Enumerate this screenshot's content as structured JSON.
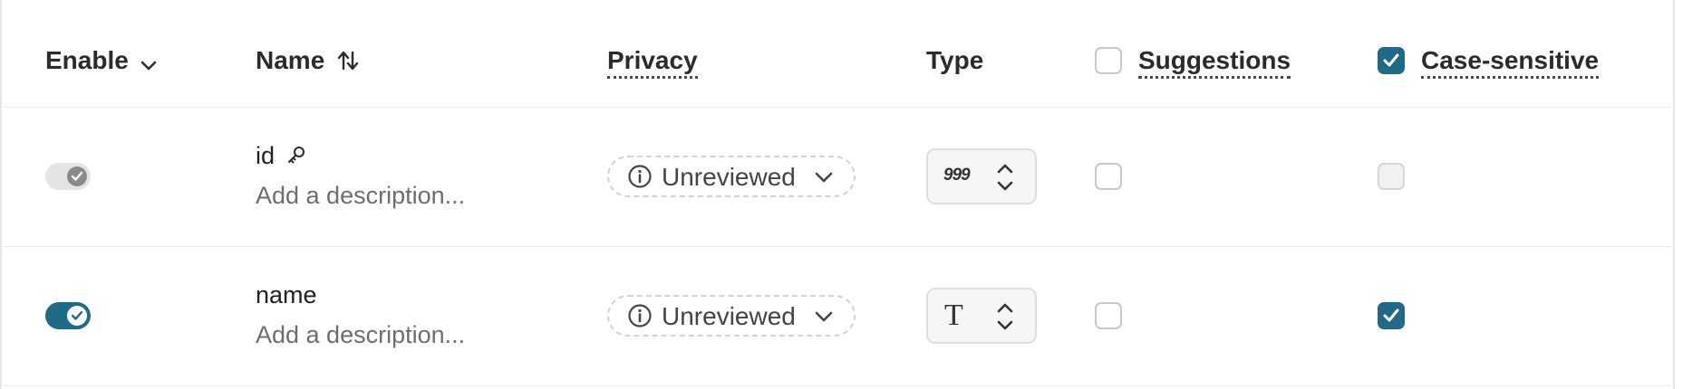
{
  "header": {
    "enable_label": "Enable",
    "name_label": "Name",
    "privacy_label": "Privacy",
    "type_label": "Type",
    "suggestions_label": "Suggestions",
    "case_sensitive_label": "Case-sensitive",
    "suggestions_all_checked": false,
    "case_sensitive_all_checked": true
  },
  "rows": [
    {
      "enabled": true,
      "enable_disabled": true,
      "name": "id",
      "is_key": true,
      "description_placeholder": "Add a description...",
      "privacy": "Unreviewed",
      "type_icon": "number-icon",
      "type_glyph": "999",
      "suggestions": false,
      "case_sensitive": false,
      "case_sensitive_disabled": true
    },
    {
      "enabled": true,
      "enable_disabled": false,
      "name": "name",
      "is_key": false,
      "description_placeholder": "Add a description...",
      "privacy": "Unreviewed",
      "type_icon": "text-icon",
      "type_glyph": "T",
      "suggestions": false,
      "case_sensitive": true,
      "case_sensitive_disabled": false
    }
  ],
  "colors": {
    "accent": "#1e6a87",
    "border": "#e6e6e6",
    "muted_text": "#6e6e6e"
  }
}
